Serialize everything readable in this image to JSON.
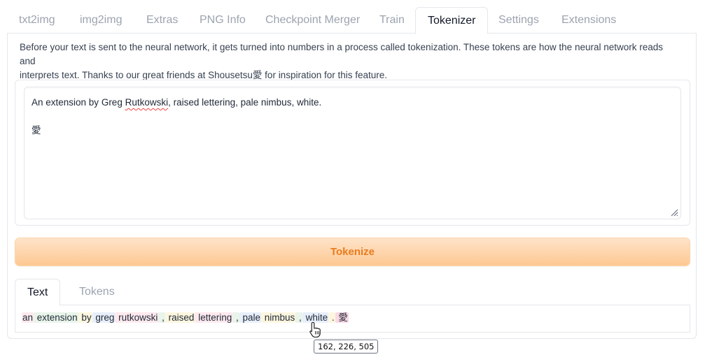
{
  "tabs": [
    {
      "label": "txt2img"
    },
    {
      "label": "img2img"
    },
    {
      "label": "Extras"
    },
    {
      "label": "PNG Info"
    },
    {
      "label": "Checkpoint Merger"
    },
    {
      "label": "Train"
    },
    {
      "label": "Tokenizer",
      "active": true
    },
    {
      "label": "Settings"
    },
    {
      "label": "Extensions"
    }
  ],
  "tokenizer": {
    "description_line1": "Before your text is sent to the neural network, it gets turned into numbers in a process called tokenization. These tokens are how the neural network reads and",
    "description_line2": "interprets text. Thanks to our great friends at Shousetsu愛 for inspiration for this feature.",
    "input": {
      "line1_pre": "An extension by Greg ",
      "line1_misspelled": "Rutkowski",
      "line1_post": ", raised lettering, pale nimbus, white.",
      "line2": "",
      "line3": "愛"
    },
    "tokenize_label": "Tokenize",
    "output_tabs": [
      {
        "label": "Text",
        "active": true
      },
      {
        "label": "Tokens"
      }
    ],
    "tokens": [
      "an",
      " extension",
      " by",
      " greg",
      " rutkowski",
      " ,",
      " raised",
      " lettering",
      " ,",
      " pale",
      " nimbus",
      " ,",
      " white",
      " .",
      " 愛"
    ],
    "tooltip": "162, 226, 505"
  },
  "colors": {
    "accent": "#ea7c1e",
    "button_gradient_top": "#fee3c9",
    "button_gradient_bottom": "#fdc892",
    "token_bg_pink": "#fde9ee",
    "token_bg_green": "#e9f4ea",
    "token_bg_yellow": "#fdf6df",
    "token_bg_blue": "#e8effa",
    "token_bg_highlight": "#f9d9e3"
  },
  "icons": {
    "resize_handle": "resize-grip-icon",
    "cursor": "hand-pointer-icon"
  }
}
